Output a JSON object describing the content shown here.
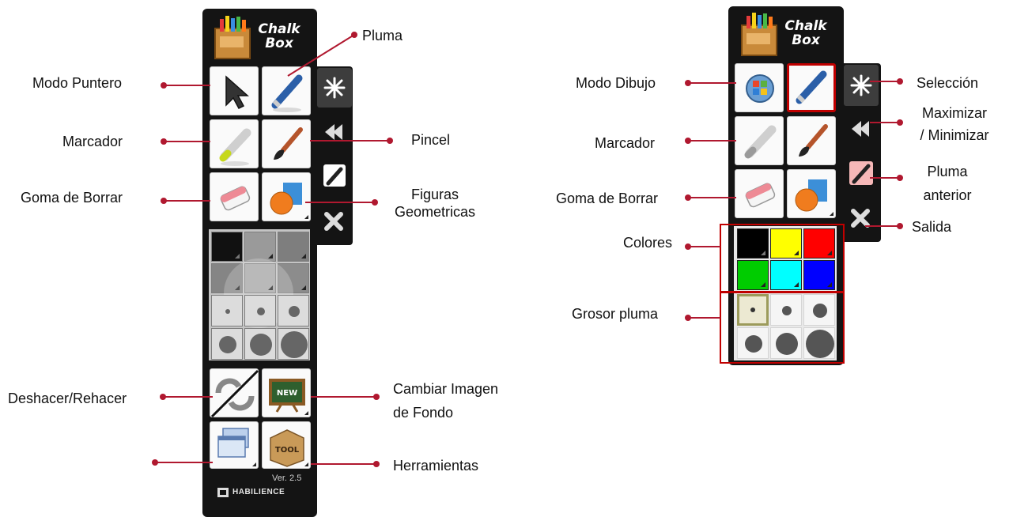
{
  "left_panel": {
    "logo_line1": "Chalk",
    "logo_line2": "Box",
    "version": "Ver. 2.5",
    "brand": "HABILIENCE",
    "labels": {
      "modo_puntero": "Modo Puntero",
      "pluma": "Pluma",
      "marcador": "Marcador",
      "pincel": "Pincel",
      "goma": "Goma de Borrar",
      "figuras_1": "Figuras",
      "figuras_2": "Geometricas",
      "deshacer": "Deshacer/Rehacer",
      "cambiar_1": "Cambiar Imagen",
      "cambiar_2": "de Fondo",
      "herramientas": "Herramientas"
    },
    "new_badge": "NEW",
    "tool_badge": "TOOL"
  },
  "right_panel": {
    "logo_line1": "Chalk",
    "logo_line2": "Box",
    "labels": {
      "modo_dibujo": "Modo Dibujo",
      "seleccion": "Selección",
      "max_1": "Maximizar",
      "max_2": "/ Minimizar",
      "marcador": "Marcador",
      "pluma_ant_1": "Pluma",
      "pluma_ant_2": "anterior",
      "goma": "Goma de Borrar",
      "salida": "Salida",
      "colores": "Colores",
      "grosor": "Grosor pluma"
    },
    "colors": [
      "#000000",
      "#ffff00",
      "#ff0000",
      "#00cc00",
      "#00ffff",
      "#0000ff"
    ],
    "accent_callout": "#b0182f",
    "highlight_box": "#c00000"
  }
}
